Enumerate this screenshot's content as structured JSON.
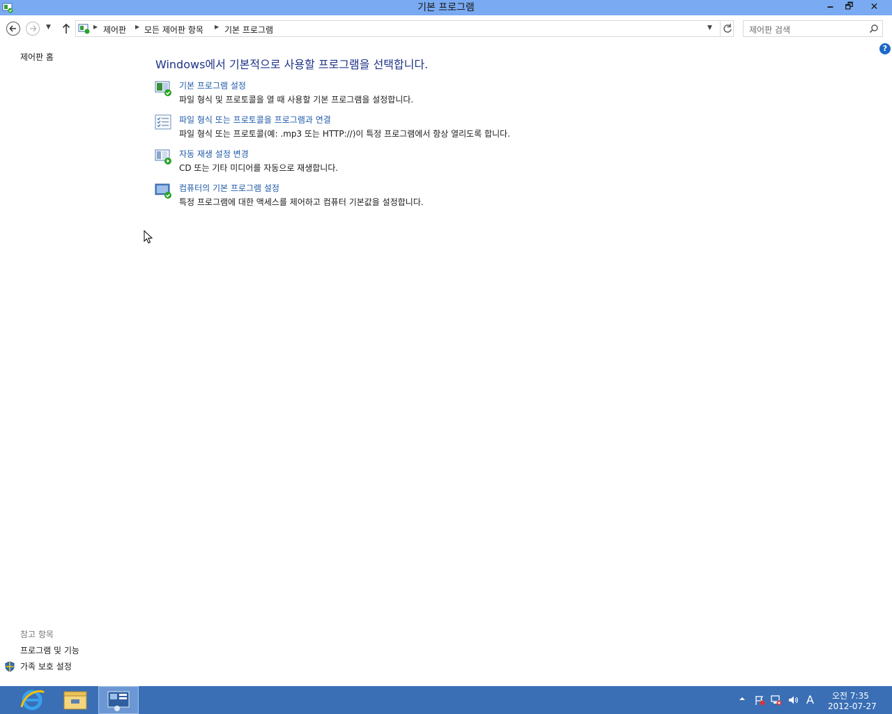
{
  "window": {
    "title": "기본 프로그램",
    "minimize_glyph": "🗕",
    "maximize_glyph": "🗗",
    "close_glyph": "✕"
  },
  "address_bar": {
    "breadcrumb": [
      "제어판",
      "모든 제어판 항목",
      "기본 프로그램"
    ],
    "search_placeholder": "제어판 검색"
  },
  "sidebar": {
    "home_link": "제어판 홈",
    "see_also_label": "참고 항목",
    "see_also_links": [
      "프로그램 및 기능",
      "가족 보호 설정"
    ]
  },
  "main": {
    "heading": "Windows에서 기본적으로 사용할 프로그램을 선택합니다.",
    "tasks": [
      {
        "link": "기본 프로그램 설정",
        "description": "파일 형식 및 프로토콜을 열 때 사용할 기본 프로그램을 설정합니다.",
        "icon": "default-programs-icon"
      },
      {
        "link": "파일 형식 또는 프로토콜을 프로그램과 연결",
        "description": "파일 형식 또는 프로토콜(예: .mp3 또는 HTTP://)이 특정 프로그램에서 항상 열리도록 합니다.",
        "icon": "file-association-icon"
      },
      {
        "link": "자동 재생 설정 변경",
        "description": "CD 또는 기타 미디어를 자동으로 재생합니다.",
        "icon": "autoplay-icon"
      },
      {
        "link": "컴퓨터의 기본 프로그램 설정",
        "description": "특정 프로그램에 대한 액세스를 제어하고 컴퓨터 기본값을 설정합니다.",
        "icon": "program-access-icon"
      }
    ],
    "help_glyph": "?"
  },
  "taskbar": {
    "tray_ime": "A",
    "clock_time": "오전 7:35",
    "clock_date": "2012-07-27"
  },
  "colors": {
    "titlebar": "#79aaf2",
    "link": "#1e5aa8",
    "heading": "#1e3287",
    "taskbar": "#3a6fb5"
  }
}
